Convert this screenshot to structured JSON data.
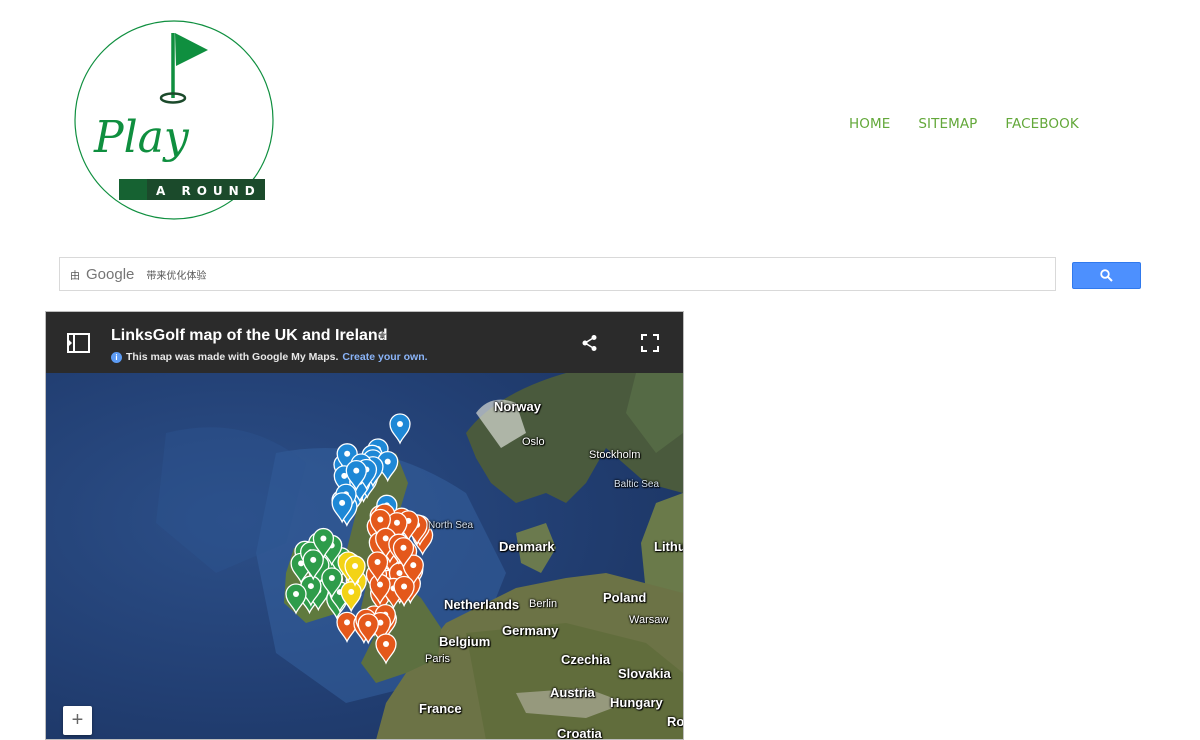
{
  "logo": {
    "word": "Play",
    "bar_text": "A ROUND",
    "color": "#0f8f3f"
  },
  "nav": {
    "items": [
      "HOME",
      "SITEMAP",
      "FACEBOOK"
    ],
    "color": "#63a83a"
  },
  "search": {
    "by_text": "由",
    "brand": "Google",
    "placeholder_text": "带来优化体验",
    "button_color": "#4d90fe",
    "button_icon": "search-icon"
  },
  "map": {
    "title": "LinksGolf map of the UK and Ireland",
    "subtitle": "This map was made with Google My Maps.",
    "subtitle_link": "Create your own.",
    "zoom_in": "+",
    "labels": {
      "norway": "Norway",
      "oslo": "Oslo",
      "stockholm": "Stockholm",
      "baltic_sea": "Baltic Sea",
      "north_sea": "North Sea",
      "denmark": "Denmark",
      "lithuania": "Lithu",
      "netherlands": "Netherlands",
      "berlin": "Berlin",
      "poland": "Poland",
      "warsaw": "Warsaw",
      "germany": "Germany",
      "belgium": "Belgium",
      "paris": "Paris",
      "czechia": "Czechia",
      "slovakia": "Slovakia",
      "austria": "Austria",
      "hungary": "Hungary",
      "france": "France",
      "croatia": "Croatia",
      "romania": "Ro"
    },
    "pin_colors": {
      "scotland": "#1e88d6",
      "ireland": "#2e9c4a",
      "england": "#e4581b",
      "wales": "#f3d316"
    }
  }
}
